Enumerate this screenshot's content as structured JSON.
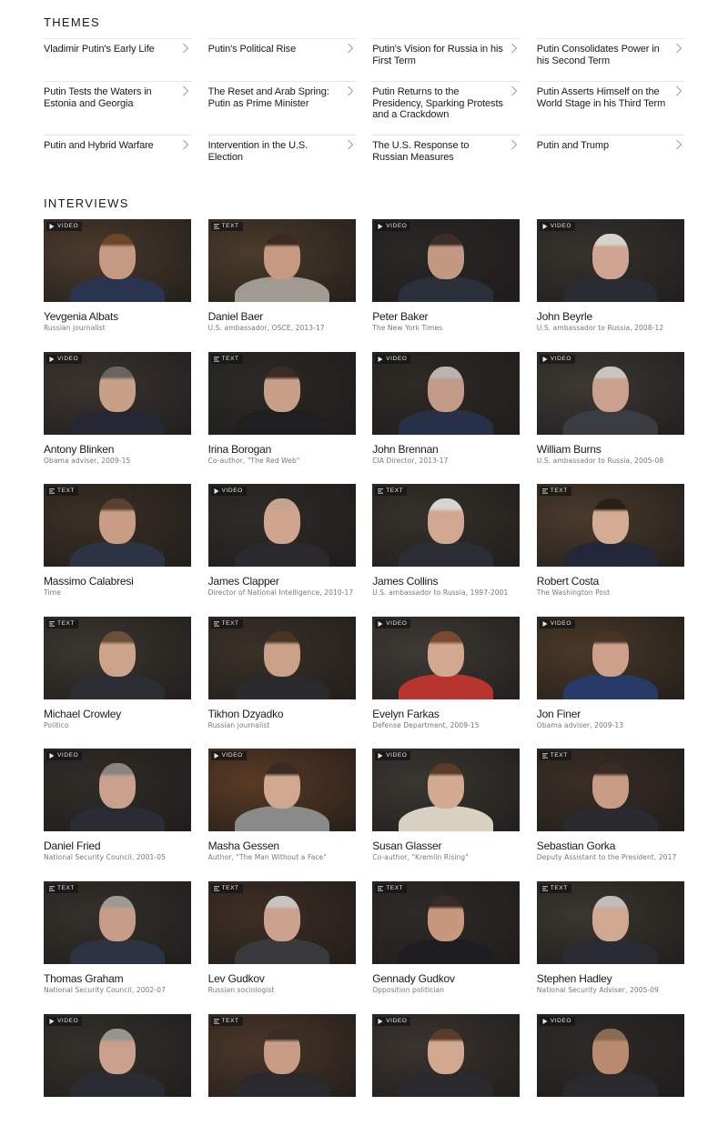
{
  "themes": {
    "title": "THEMES",
    "items": [
      {
        "label": "Vladimir Putin's Early Life"
      },
      {
        "label": "Putin's Political Rise"
      },
      {
        "label": "Putin's Vision for Russia in his First Term"
      },
      {
        "label": "Putin Consolidates Power in his Second Term"
      },
      {
        "label": "Putin Tests the Waters in Estonia and Georgia"
      },
      {
        "label": "The Reset and Arab Spring: Putin as Prime Minister"
      },
      {
        "label": "Putin Returns to the Presidency, Sparking Protests and a Crackdown"
      },
      {
        "label": "Putin Asserts Himself on the World Stage in his Third Term"
      },
      {
        "label": "Putin and Hybrid Warfare"
      },
      {
        "label": "Intervention in the U.S. Election"
      },
      {
        "label": "The U.S. Response to Russian Measures"
      },
      {
        "label": "Putin and Trump"
      }
    ]
  },
  "interviews": {
    "title": "INTERVIEWS",
    "badge_labels": {
      "video": "VIDEO",
      "text": "TEXT"
    },
    "items": [
      {
        "name": "Yevgenia Albats",
        "desc": "Russian journalist",
        "type": "video",
        "badge": "VIDEO",
        "bg": "#4a3a2c",
        "shirt": "#2a3350",
        "skin": "#c49a84",
        "hair": "#6b4628"
      },
      {
        "name": "Daniel Baer",
        "desc": "U.S. ambassador, OSCE, 2013-17",
        "type": "text",
        "badge": "TEXT",
        "bg": "#4b3b2a",
        "shirt": "#a09a92",
        "skin": "#c69a80",
        "hair": "#3a2a20"
      },
      {
        "name": "Peter Baker",
        "desc": "The New York Times",
        "type": "video",
        "badge": "VIDEO",
        "bg": "#2a2826",
        "shirt": "#2b2f3a",
        "skin": "#c29a84",
        "hair": "#3a2e26"
      },
      {
        "name": "John Beyrle",
        "desc": "U.S. ambassador to Russia, 2008-12",
        "type": "video",
        "badge": "VIDEO",
        "bg": "#36322e",
        "shirt": "#2a2c33",
        "skin": "#cfa592",
        "hair": "#d6d2cc"
      },
      {
        "name": "Antony Blinken",
        "desc": "Obama adviser, 2009-15",
        "type": "video",
        "badge": "VIDEO",
        "bg": "#3a3430",
        "shirt": "#252833",
        "skin": "#c8a08a",
        "hair": "#6a6460"
      },
      {
        "name": "Irina Borogan",
        "desc": "Co-author, \"The Red Web\"",
        "type": "text",
        "badge": "TEXT",
        "bg": "#2c2a27",
        "shirt": "#1f1f22",
        "skin": "#c8a08a",
        "hair": "#3a2c22"
      },
      {
        "name": "John Brennan",
        "desc": "CIA Director, 2013-17",
        "type": "video",
        "badge": "VIDEO",
        "bg": "#2e2a26",
        "shirt": "#263046",
        "skin": "#c29a88",
        "hair": "#b8b4b0"
      },
      {
        "name": "William Burns",
        "desc": "U.S. ambassador to Russia, 2005-08",
        "type": "video",
        "badge": "VIDEO",
        "bg": "#3c3834",
        "shirt": "#3a3c44",
        "skin": "#caa08c",
        "hair": "#c8c4c0"
      },
      {
        "name": "Massimo Calabresi",
        "desc": "Time",
        "type": "text",
        "badge": "TEXT",
        "bg": "#3a3026",
        "shirt": "#2c3444",
        "skin": "#c89c84",
        "hair": "#5a4030"
      },
      {
        "name": "James Clapper",
        "desc": "Director of National Intelligence, 2010-17",
        "type": "video",
        "badge": "VIDEO",
        "bg": "#2e2b28",
        "shirt": "#2a2a2e",
        "skin": "#d0a48e",
        "hair": "#c4a48e"
      },
      {
        "name": "James Collins",
        "desc": "U.S. ambassador to Russia, 1997-2001",
        "type": "text",
        "badge": "TEXT",
        "bg": "#35312c",
        "shirt": "#2c2e36",
        "skin": "#d0a892",
        "hair": "#d8d4d0"
      },
      {
        "name": "Robert Costa",
        "desc": "The Washington Post",
        "type": "text",
        "badge": "TEXT",
        "bg": "#4a3a2c",
        "shirt": "#22283a",
        "skin": "#d4ac94",
        "hair": "#2a2018"
      },
      {
        "name": "Michael Crowley",
        "desc": "Politico",
        "type": "text",
        "badge": "TEXT",
        "bg": "#3a3630",
        "shirt": "#2c2e34",
        "skin": "#cca48c",
        "hair": "#6a5038"
      },
      {
        "name": "Tikhon Dzyadko",
        "desc": "Russian journalist",
        "type": "text",
        "badge": "TEXT",
        "bg": "#3a3128",
        "shirt": "#2a2a2c",
        "skin": "#caa088",
        "hair": "#4a3424"
      },
      {
        "name": "Evelyn Farkas",
        "desc": "Defense Department, 2009-15",
        "type": "video",
        "badge": "VIDEO",
        "bg": "#3e3a36",
        "shirt": "#b8342e",
        "skin": "#d2a890",
        "hair": "#7a4a30"
      },
      {
        "name": "Jon Finer",
        "desc": "Obama adviser, 2009-13",
        "type": "video",
        "badge": "VIDEO",
        "bg": "#4a3828",
        "shirt": "#283a66",
        "skin": "#cca08a",
        "hair": "#4a3424"
      },
      {
        "name": "Daniel Fried",
        "desc": "National Security Council, 2001-05",
        "type": "video",
        "badge": "VIDEO",
        "bg": "#302c28",
        "shirt": "#2a2c34",
        "skin": "#c8a08c",
        "hair": "#8a8480"
      },
      {
        "name": "Masha Gessen",
        "desc": "Author, \"The Man Without a Face\"",
        "type": "video",
        "badge": "VIDEO",
        "bg": "#5a3a24",
        "shirt": "#8a8a88",
        "skin": "#d0a890",
        "hair": "#3a2a22"
      },
      {
        "name": "Susan Glasser",
        "desc": "Co-author, \"Kremlin Rising\"",
        "type": "video",
        "badge": "VIDEO",
        "bg": "#3a3632",
        "shirt": "#d8d0c0",
        "skin": "#d2aa92",
        "hair": "#5a3a28"
      },
      {
        "name": "Sebastian Gorka",
        "desc": "Deputy Assistant to the President, 2017",
        "type": "text",
        "badge": "TEXT",
        "bg": "#3a2e26",
        "shirt": "#2a2a30",
        "skin": "#c89c84",
        "hair": "#3a2c24"
      },
      {
        "name": "Thomas Graham",
        "desc": "National Security Council, 2002-07",
        "type": "text",
        "badge": "TEXT",
        "bg": "#34302c",
        "shirt": "#2c3444",
        "skin": "#c49c88",
        "hair": "#a09890"
      },
      {
        "name": "Lev Gudkov",
        "desc": "Russian sociologist",
        "type": "text",
        "badge": "TEXT",
        "bg": "#3e2e24",
        "shirt": "#3a3a3e",
        "skin": "#caa28e",
        "hair": "#c8c4c0"
      },
      {
        "name": "Gennady Gudkov",
        "desc": "Opposition politician",
        "type": "text",
        "badge": "TEXT",
        "bg": "#2e2a28",
        "shirt": "#1e1e22",
        "skin": "#c8987e",
        "hair": "#3a2c24"
      },
      {
        "name": "Stephen Hadley",
        "desc": "National Security Adviser, 2005-09",
        "type": "text",
        "badge": "TEXT",
        "bg": "#3a3630",
        "shirt": "#2a2c34",
        "skin": "#d0a892",
        "hair": "#c0bcb6"
      },
      {
        "name": "",
        "desc": "",
        "type": "video",
        "badge": "VIDEO",
        "bg": "#34302c",
        "shirt": "#2a2c34",
        "skin": "#c8a08c",
        "hair": "#9a948e"
      },
      {
        "name": "",
        "desc": "",
        "type": "text",
        "badge": "TEXT",
        "bg": "#4a3628",
        "shirt": "#2a2a2e",
        "skin": "#c89c84",
        "hair": "#3a2c24"
      },
      {
        "name": "",
        "desc": "",
        "type": "video",
        "badge": "VIDEO",
        "bg": "#3a3430",
        "shirt": "#2a2a2e",
        "skin": "#d0a890",
        "hair": "#5a3a28"
      },
      {
        "name": "",
        "desc": "",
        "type": "video",
        "badge": "VIDEO",
        "bg": "#2e2a28",
        "shirt": "#2a2a2e",
        "skin": "#b88a70",
        "hair": "#8a6a52"
      }
    ]
  }
}
